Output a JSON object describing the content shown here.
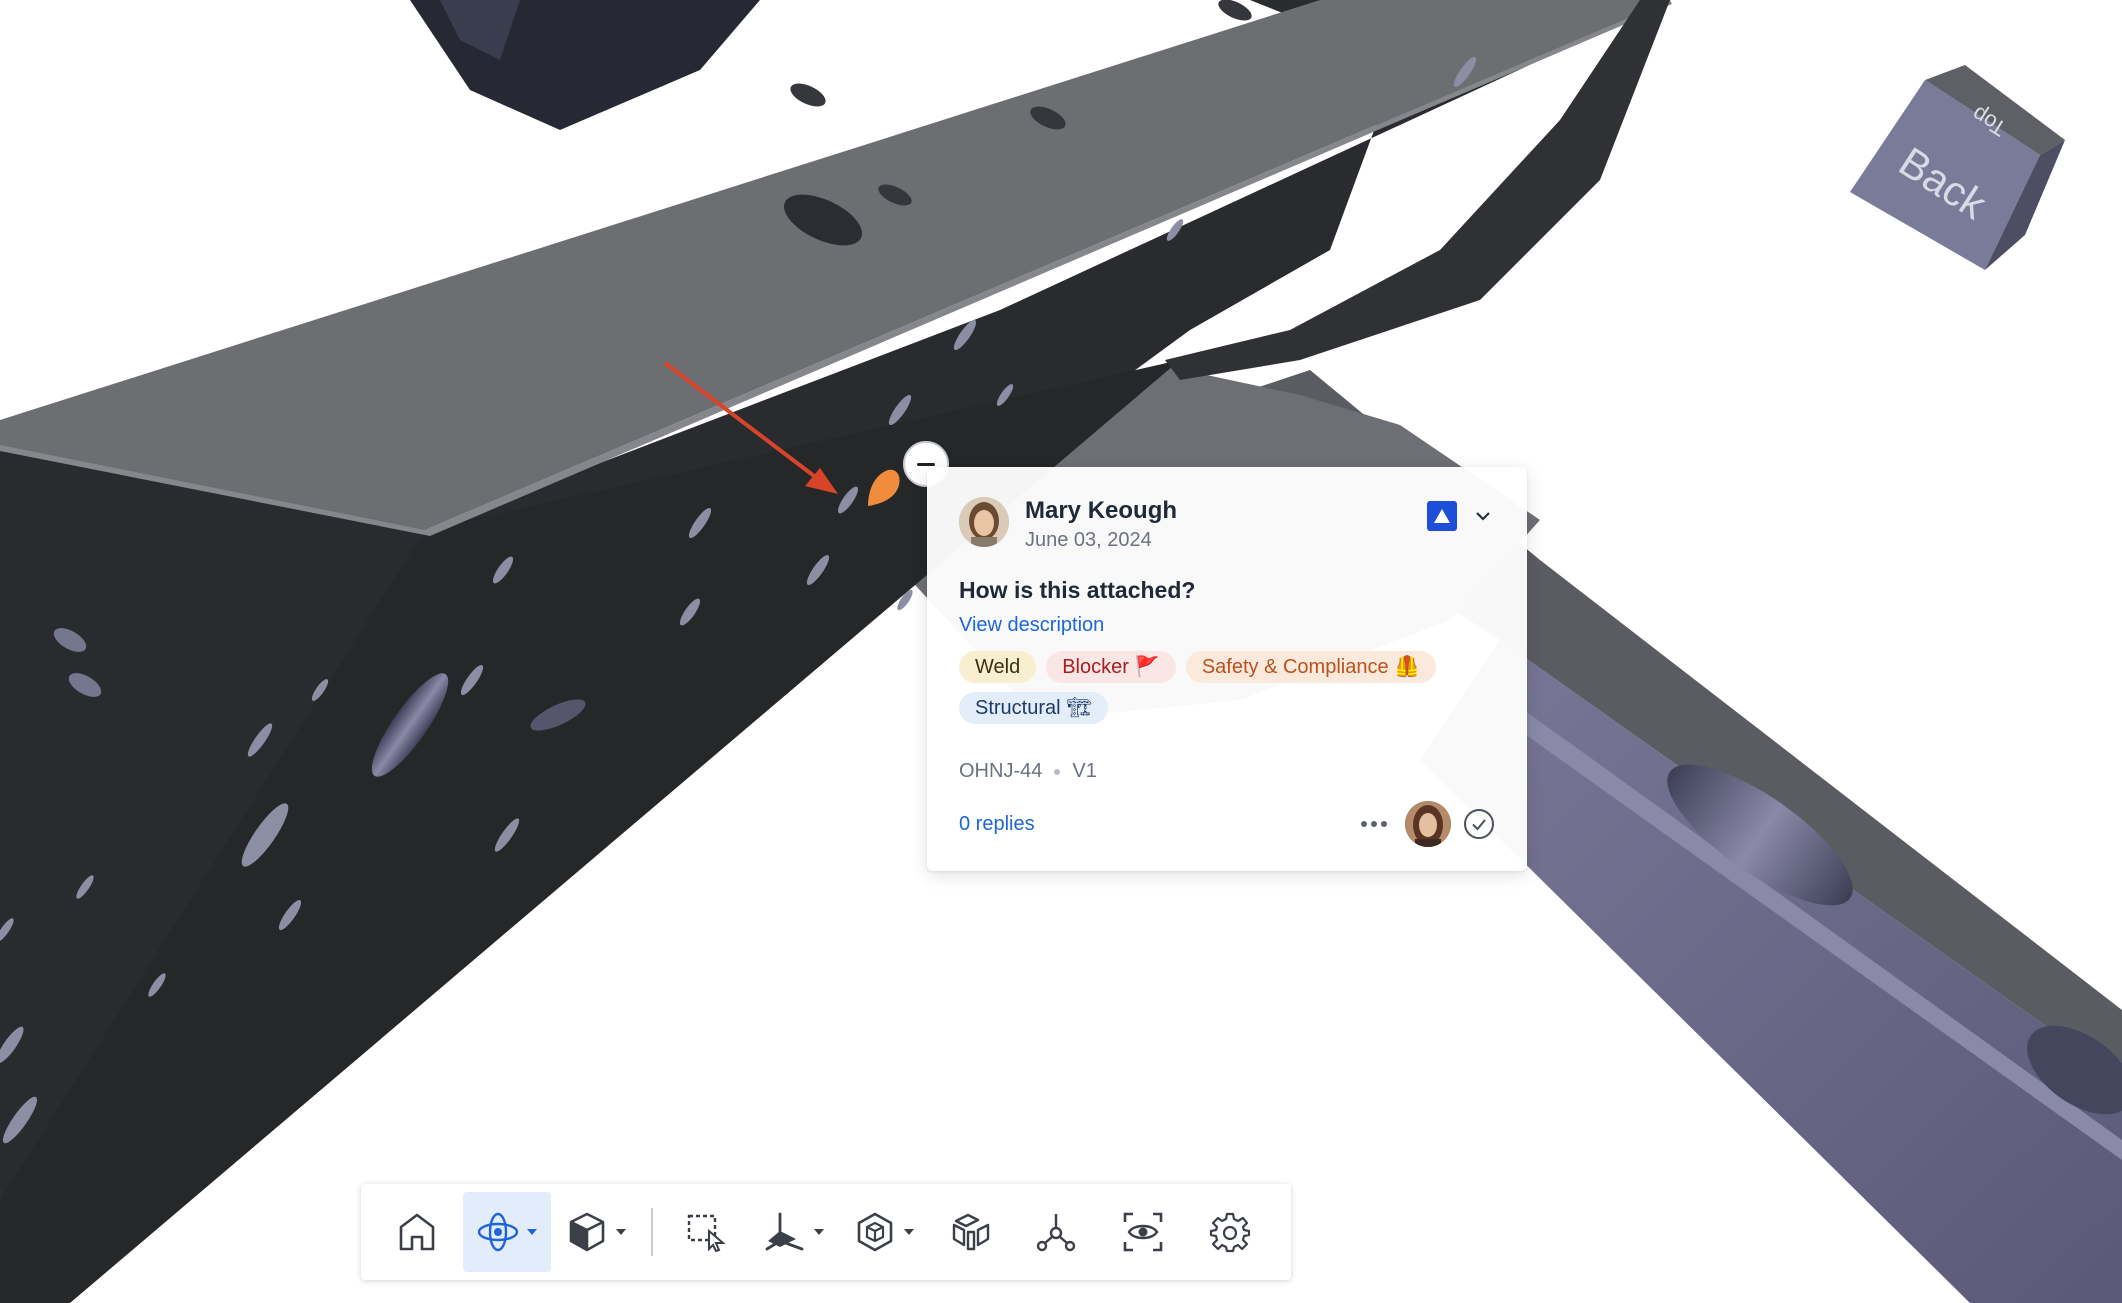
{
  "comment": {
    "author": "Mary Keough",
    "date": "June 03, 2024",
    "title": "How is this attached?",
    "view_description": "View description",
    "tags": [
      {
        "label": "Weld",
        "emoji": ""
      },
      {
        "label": "Blocker",
        "emoji": "🚩"
      },
      {
        "label": "Safety & Compliance",
        "emoji": "🦺"
      },
      {
        "label": "Structural",
        "emoji": "🏗"
      }
    ],
    "issue_id": "OHNJ-44",
    "version": "V1",
    "replies": "0 replies",
    "priority_color": "#1d4ed8"
  },
  "viewcube": {
    "front_face": "Back",
    "top_face": "Top"
  },
  "toolbar": {
    "buttons": [
      {
        "name": "home",
        "icon": "home-icon",
        "active": false,
        "dropdown": false
      },
      {
        "name": "orbit",
        "icon": "orbit-icon",
        "active": true,
        "dropdown": true
      },
      {
        "name": "view-cube",
        "icon": "cube-icon",
        "active": false,
        "dropdown": true
      },
      {
        "name": "box-select",
        "icon": "box-select-icon",
        "active": false,
        "dropdown": false
      },
      {
        "name": "section",
        "icon": "section-axes-icon",
        "active": false,
        "dropdown": true
      },
      {
        "name": "explode",
        "icon": "explode-cube-icon",
        "active": false,
        "dropdown": true
      },
      {
        "name": "model-browser",
        "icon": "exploded-parts-icon",
        "active": false,
        "dropdown": false
      },
      {
        "name": "structure",
        "icon": "structure-tree-icon",
        "active": false,
        "dropdown": false
      },
      {
        "name": "focus-view",
        "icon": "focus-eye-icon",
        "active": false,
        "dropdown": false
      },
      {
        "name": "settings",
        "icon": "gear-icon",
        "active": false,
        "dropdown": false
      }
    ]
  },
  "colors": {
    "accent": "#1d65d8",
    "beam_dark": "#2b2c30",
    "beam_top": "#6c6e72",
    "beam_purple": "#6f6d8c",
    "annotation_arrow": "#d8442a",
    "pin": "#f08c3c"
  }
}
